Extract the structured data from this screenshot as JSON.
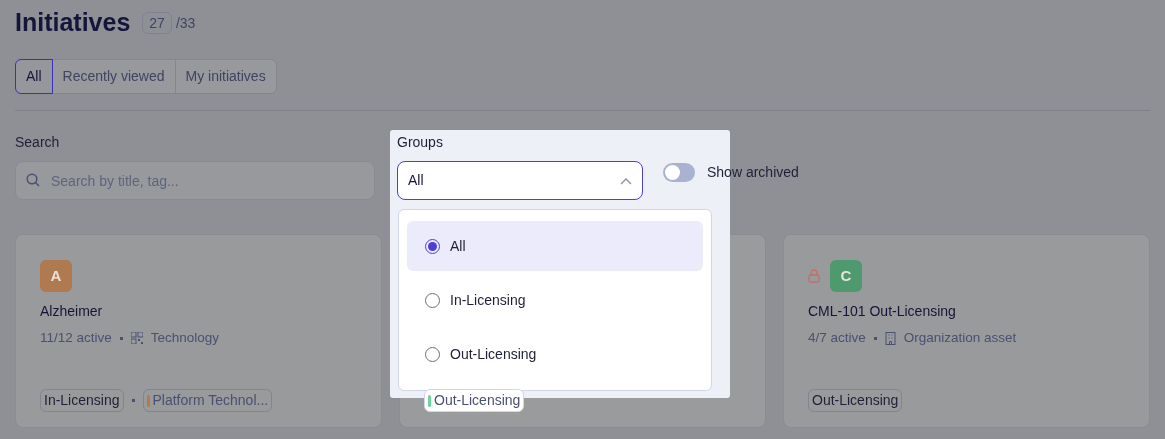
{
  "title": "Initiatives",
  "count": "27",
  "total": "/33",
  "tabs": [
    {
      "label": "All",
      "selected": true
    },
    {
      "label": "Recently viewed",
      "selected": false
    },
    {
      "label": "My initiatives",
      "selected": false
    }
  ],
  "search": {
    "label": "Search",
    "placeholder": "Search by title, tag..."
  },
  "groups": {
    "label": "Groups",
    "value": "All",
    "expanded": true,
    "options": [
      {
        "label": "All",
        "selected": true
      },
      {
        "label": "In-Licensing",
        "selected": false
      },
      {
        "label": "Out-Licensing",
        "selected": false
      }
    ]
  },
  "show_archived": {
    "label": "Show archived",
    "on": false
  },
  "cards": [
    {
      "avatar": "A",
      "color": "#b07a50",
      "locked": false,
      "name": "Alzheimer",
      "active": "11/12 active",
      "kind": "technology",
      "category": "Technology",
      "tags": [
        {
          "label": "In-Licensing"
        },
        {
          "label": "Platform Technol...",
          "color": "#b8784a"
        }
      ]
    },
    {
      "tags": [
        {
          "label": "Out-Licensing",
          "color": "#6fd39a"
        }
      ]
    },
    {
      "avatar": "C",
      "color": "#4e9a6e",
      "locked": true,
      "name": "CML-101 Out-Licensing",
      "active": "4/7 active",
      "kind": "organization",
      "category": "Organization asset",
      "tags": [
        {
          "label": "Out-Licensing"
        }
      ]
    }
  ]
}
